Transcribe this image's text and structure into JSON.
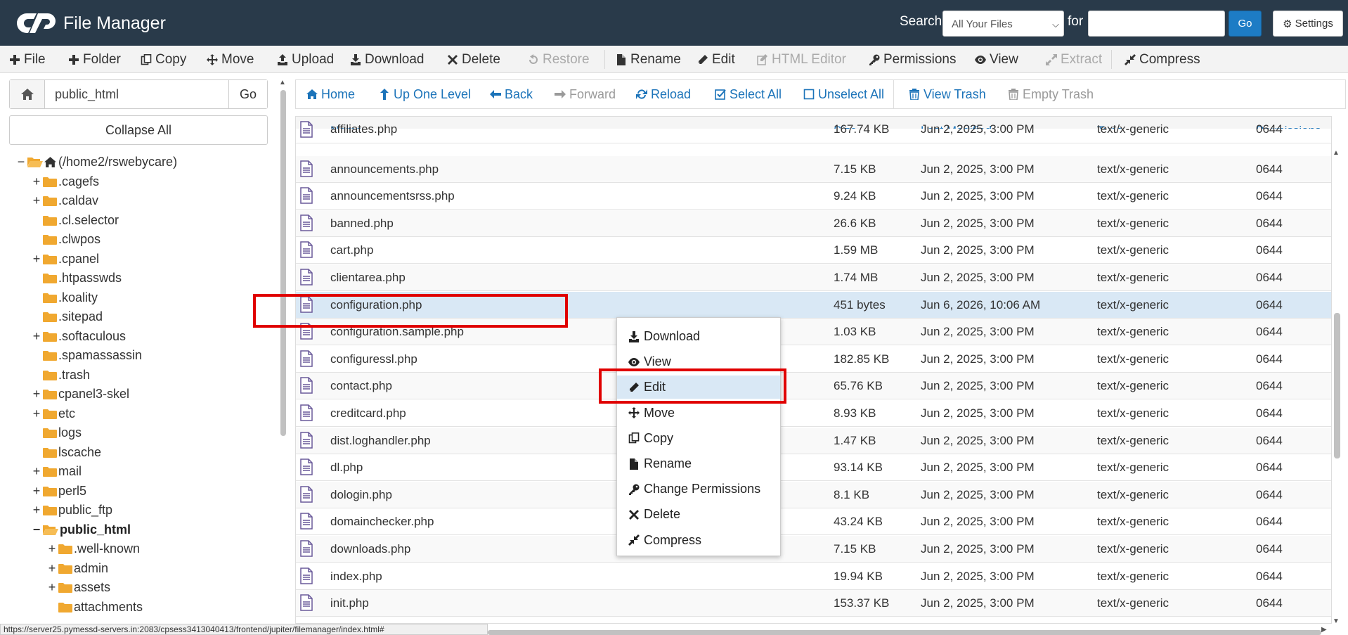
{
  "app": {
    "title": "File Manager",
    "search_label": "Search",
    "search_scope": "All Your Files",
    "for_label": "for",
    "search_value": "",
    "go_label": "Go",
    "settings_label": "Settings"
  },
  "toolbar": [
    {
      "label": "File",
      "icon": "plus-icon",
      "disabled": false
    },
    {
      "label": "Folder",
      "icon": "plus-icon",
      "disabled": false
    },
    {
      "label": "Copy",
      "icon": "copy-icon",
      "disabled": false
    },
    {
      "label": "Move",
      "icon": "move-icon",
      "disabled": false
    },
    {
      "label": "Upload",
      "icon": "upload-icon",
      "disabled": false
    },
    {
      "label": "Download",
      "icon": "download-icon",
      "disabled": false
    },
    {
      "label": "Delete",
      "icon": "close-icon",
      "disabled": false
    },
    {
      "label": "Restore",
      "icon": "undo-icon",
      "disabled": true
    },
    {
      "label": "Rename",
      "icon": "file-icon",
      "disabled": false
    },
    {
      "label": "Edit",
      "icon": "pencil-icon",
      "disabled": false
    },
    {
      "label": "HTML Editor",
      "icon": "edit-square-icon",
      "disabled": true
    },
    {
      "label": "Permissions",
      "icon": "key-icon",
      "disabled": false
    },
    {
      "label": "View",
      "icon": "eye-icon",
      "disabled": false
    },
    {
      "label": "Extract",
      "icon": "expand-icon",
      "disabled": true
    },
    {
      "label": "Compress",
      "icon": "compress-icon",
      "disabled": false
    }
  ],
  "left": {
    "path_value": "public_html",
    "go_label": "Go",
    "collapse_label": "Collapse All",
    "tree": [
      {
        "label": "(/home2/rswebycare)",
        "toggle": "−",
        "level": 0,
        "root": true
      },
      {
        "label": ".cagefs",
        "toggle": "+",
        "level": 1
      },
      {
        "label": ".caldav",
        "toggle": "+",
        "level": 1
      },
      {
        "label": ".cl.selector",
        "toggle": "",
        "level": 1
      },
      {
        "label": ".clwpos",
        "toggle": "",
        "level": 1
      },
      {
        "label": ".cpanel",
        "toggle": "+",
        "level": 1
      },
      {
        "label": ".htpasswds",
        "toggle": "",
        "level": 1
      },
      {
        "label": ".koality",
        "toggle": "",
        "level": 1
      },
      {
        "label": ".sitepad",
        "toggle": "",
        "level": 1
      },
      {
        "label": ".softaculous",
        "toggle": "+",
        "level": 1
      },
      {
        "label": ".spamassassin",
        "toggle": "",
        "level": 1
      },
      {
        "label": ".trash",
        "toggle": "",
        "level": 1
      },
      {
        "label": "cpanel3-skel",
        "toggle": "+",
        "level": 1
      },
      {
        "label": "etc",
        "toggle": "+",
        "level": 1
      },
      {
        "label": "logs",
        "toggle": "",
        "level": 1
      },
      {
        "label": "lscache",
        "toggle": "",
        "level": 1
      },
      {
        "label": "mail",
        "toggle": "+",
        "level": 1
      },
      {
        "label": "perl5",
        "toggle": "+",
        "level": 1
      },
      {
        "label": "public_ftp",
        "toggle": "+",
        "level": 1
      },
      {
        "label": "public_html",
        "toggle": "−",
        "level": 1,
        "bold": true,
        "open": true
      },
      {
        "label": ".well-known",
        "toggle": "+",
        "level": 2
      },
      {
        "label": "admin",
        "toggle": "+",
        "level": 2
      },
      {
        "label": "assets",
        "toggle": "+",
        "level": 2
      },
      {
        "label": "attachments",
        "toggle": "",
        "level": 2
      }
    ]
  },
  "nav": [
    {
      "label": "Home",
      "icon": "home-icon",
      "disabled": false
    },
    {
      "label": "Up One Level",
      "icon": "arrow-up-icon",
      "disabled": false
    },
    {
      "label": "Back",
      "icon": "arrow-left-icon",
      "disabled": false
    },
    {
      "label": "Forward",
      "icon": "arrow-right-icon",
      "disabled": true
    },
    {
      "label": "Reload",
      "icon": "refresh-icon",
      "disabled": false
    },
    {
      "label": "Select All",
      "icon": "checkbox-checked-icon",
      "disabled": false
    },
    {
      "label": "Unselect All",
      "icon": "checkbox-empty-icon",
      "disabled": false
    },
    {
      "label": "View Trash",
      "icon": "trash-icon",
      "disabled": false
    },
    {
      "label": "Empty Trash",
      "icon": "trash-icon",
      "disabled": true
    }
  ],
  "table": {
    "columns": [
      "Name",
      "Size",
      "Last Modified",
      "Type",
      "Permissions"
    ],
    "rows": [
      {
        "name": "affiliates.php",
        "size": "167.74 KB",
        "modified": "Jun 2, 2025, 3:00 PM",
        "type": "text/x-generic",
        "perms": "0644"
      },
      {
        "name": "announcements.php",
        "size": "7.15 KB",
        "modified": "Jun 2, 2025, 3:00 PM",
        "type": "text/x-generic",
        "perms": "0644"
      },
      {
        "name": "announcementsrss.php",
        "size": "9.24 KB",
        "modified": "Jun 2, 2025, 3:00 PM",
        "type": "text/x-generic",
        "perms": "0644"
      },
      {
        "name": "banned.php",
        "size": "26.6 KB",
        "modified": "Jun 2, 2025, 3:00 PM",
        "type": "text/x-generic",
        "perms": "0644"
      },
      {
        "name": "cart.php",
        "size": "1.59 MB",
        "modified": "Jun 2, 2025, 3:00 PM",
        "type": "text/x-generic",
        "perms": "0644"
      },
      {
        "name": "clientarea.php",
        "size": "1.74 MB",
        "modified": "Jun 2, 2025, 3:00 PM",
        "type": "text/x-generic",
        "perms": "0644"
      },
      {
        "name": "configuration.php",
        "size": "451 bytes",
        "modified": "Jun 6, 2026, 10:06 AM",
        "type": "text/x-generic",
        "perms": "0644",
        "selected": true
      },
      {
        "name": "configuration.sample.php",
        "size": "1.03 KB",
        "modified": "Jun 2, 2025, 3:00 PM",
        "type": "text/x-generic",
        "perms": "0644"
      },
      {
        "name": "configuressl.php",
        "size": "182.85 KB",
        "modified": "Jun 2, 2025, 3:00 PM",
        "type": "text/x-generic",
        "perms": "0644"
      },
      {
        "name": "contact.php",
        "size": "65.76 KB",
        "modified": "Jun 2, 2025, 3:00 PM",
        "type": "text/x-generic",
        "perms": "0644"
      },
      {
        "name": "creditcard.php",
        "size": "8.93 KB",
        "modified": "Jun 2, 2025, 3:00 PM",
        "type": "text/x-generic",
        "perms": "0644"
      },
      {
        "name": "dist.loghandler.php",
        "size": "1.47 KB",
        "modified": "Jun 2, 2025, 3:00 PM",
        "type": "text/x-generic",
        "perms": "0644"
      },
      {
        "name": "dl.php",
        "size": "93.14 KB",
        "modified": "Jun 2, 2025, 3:00 PM",
        "type": "text/x-generic",
        "perms": "0644"
      },
      {
        "name": "dologin.php",
        "size": "8.1 KB",
        "modified": "Jun 2, 2025, 3:00 PM",
        "type": "text/x-generic",
        "perms": "0644"
      },
      {
        "name": "domainchecker.php",
        "size": "43.24 KB",
        "modified": "Jun 2, 2025, 3:00 PM",
        "type": "text/x-generic",
        "perms": "0644"
      },
      {
        "name": "downloads.php",
        "size": "7.15 KB",
        "modified": "Jun 2, 2025, 3:00 PM",
        "type": "text/x-generic",
        "perms": "0644"
      },
      {
        "name": "index.php",
        "size": "19.94 KB",
        "modified": "Jun 2, 2025, 3:00 PM",
        "type": "text/x-generic",
        "perms": "0644"
      },
      {
        "name": "init.php",
        "size": "153.37 KB",
        "modified": "Jun 2, 2025, 3:00 PM",
        "type": "text/x-generic",
        "perms": "0644"
      }
    ]
  },
  "context_menu": [
    {
      "label": "Download",
      "icon": "download-icon"
    },
    {
      "label": "View",
      "icon": "eye-icon"
    },
    {
      "label": "Edit",
      "icon": "pencil-icon",
      "highlighted": true
    },
    {
      "label": "Move",
      "icon": "move-icon"
    },
    {
      "label": "Copy",
      "icon": "copy-icon"
    },
    {
      "label": "Rename",
      "icon": "file-icon"
    },
    {
      "label": "Change Permissions",
      "icon": "key-icon"
    },
    {
      "label": "Delete",
      "icon": "close-icon"
    },
    {
      "label": "Compress",
      "icon": "compress-icon"
    }
  ],
  "status_url": "https://server25.pymessd-servers.in:2083/cpsess3413040413/frontend/jupiter/filemanager/index.html#",
  "colors": {
    "header_bg": "#293a4a",
    "link_blue": "#1b73b9",
    "selected_row": "#d9e8f5",
    "folder": "#f0a830",
    "file_icon": "#6a5a9a",
    "highlight_red": "#e00000"
  }
}
